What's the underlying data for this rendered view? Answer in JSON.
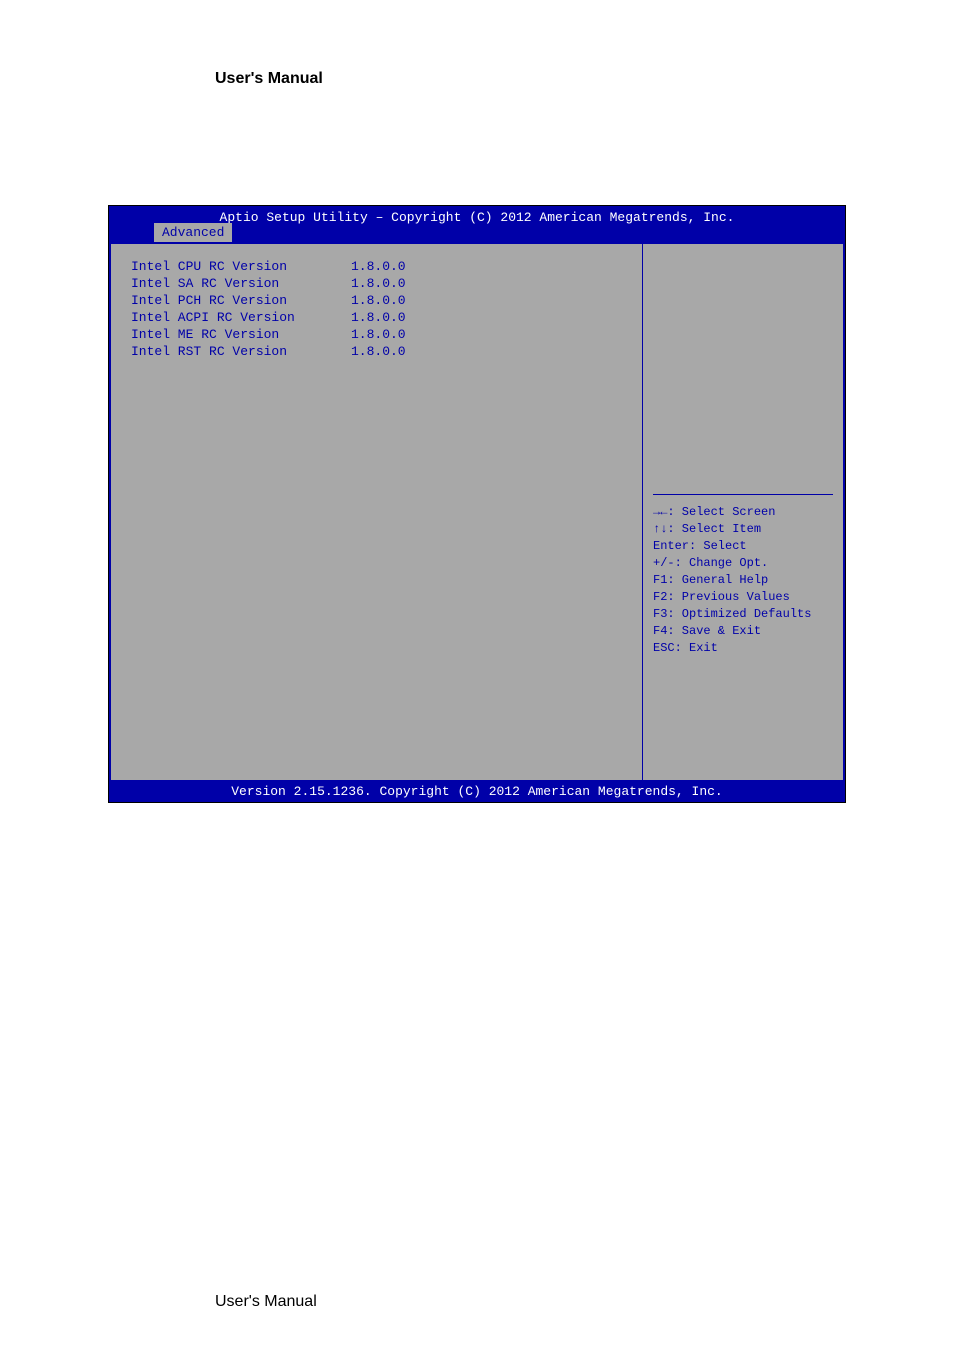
{
  "page_header": "User's Manual",
  "page_footer": "User's Manual",
  "bios": {
    "title": "Aptio Setup Utility – Copyright (C) 2012 American Megatrends, Inc.",
    "tab": "Advanced",
    "rows": [
      {
        "label": "Intel CPU RC Version",
        "value": "1.8.0.0"
      },
      {
        "label": "Intel SA RC Version",
        "value": "1.8.0.0"
      },
      {
        "label": "Intel PCH RC Version",
        "value": "1.8.0.0"
      },
      {
        "label": "Intel ACPI RC Version",
        "value": "1.8.0.0"
      },
      {
        "label": "Intel ME RC Version",
        "value": "1.8.0.0"
      },
      {
        "label": "Intel RST RC Version",
        "value": "1.8.0.0"
      }
    ],
    "help": [
      "→←: Select Screen",
      "↑↓: Select Item",
      "Enter: Select",
      "+/-: Change Opt.",
      "F1: General Help",
      "F2: Previous Values",
      "F3: Optimized Defaults",
      "F4: Save & Exit",
      "ESC: Exit"
    ],
    "footer": "Version 2.15.1236. Copyright (C) 2012 American Megatrends, Inc."
  }
}
